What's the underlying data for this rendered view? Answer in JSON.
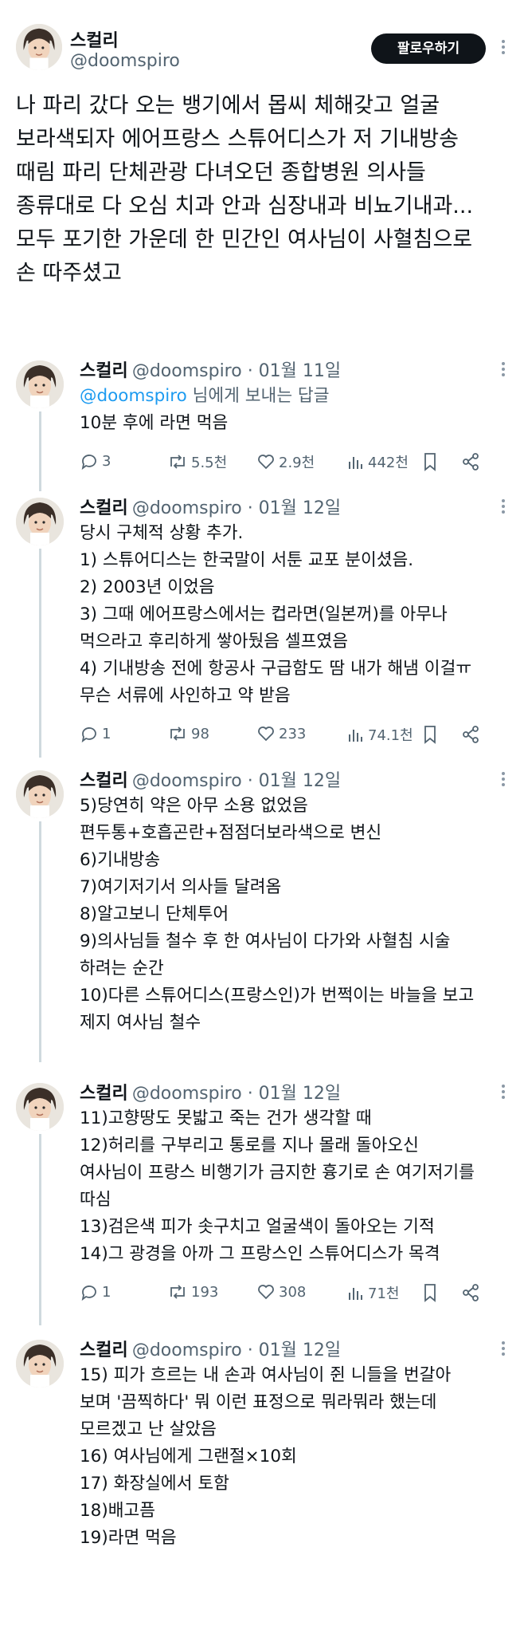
{
  "main_post": {
    "author": {
      "name": "스컬리",
      "handle": "@doomspiro"
    },
    "follow_label": "팔로우하기",
    "text_lines": [
      "나 파리 갔다 오는 뱅기에서 몹씨 체해갖고 얼굴",
      "보라색되자 에어프랑스 스튜어디스가 저 기내방송",
      "때림 파리 단체관광 다녀오던 종합병원 의사들",
      "종류대로 다 오심 치과 안과 심장내과 비뇨기내과...",
      "모두 포기한 가운데 한 민간인 여사님이 사혈침으로",
      "손 따주셨고"
    ]
  },
  "replies": [
    {
      "name": "스컬리",
      "meta": "@doomspiro · 01월 11일",
      "reply_to": {
        "mention": "@doomspiro",
        "suffix": " 님에게 보내는 답글"
      },
      "lines": [
        "10분 후에 라면 먹음"
      ],
      "stats": {
        "replies": "3",
        "retweets": "5.5천",
        "likes": "2.9천",
        "views": "442천"
      }
    },
    {
      "name": "스컬리",
      "meta": "@doomspiro · 01월 12일",
      "lines": [
        "당시 구체적 상황 추가.",
        "1) 스튜어디스는 한국말이 서툰 교포 분이셨음.",
        "2) 2003년 이었음",
        "3) 그때 에어프랑스에서는 컵라면(일본꺼)를 아무나",
        "먹으라고 후리하게 쌓아뒀음 셀프였음",
        "4) 기내방송 전에 항공사 구급함도 땀  내가 해냄 이걸ㅠ",
        "무슨 서류에 사인하고 약 받음"
      ],
      "stats": {
        "replies": "1",
        "retweets": "98",
        "likes": "233",
        "views": "74.1천"
      }
    },
    {
      "name": "스컬리",
      "meta": "@doomspiro · 01월 12일",
      "lines": [
        "5)당연히 약은 아무 소용 없었음",
        "편두통+호흡곤란+점점더보라색으로 변신",
        "6)기내방송",
        "7)여기저기서 의사들 달려옴",
        "8)알고보니 단체투어",
        "9)의사님들 철수 후 한 여사님이 다가와 사혈침 시술",
        "하려는 순간",
        "10)다른 스튜어디스(프랑스인)가 번쩍이는 바늘을 보고",
        "제지 여사님 철수"
      ]
    },
    {
      "name": "스컬리",
      "meta": "@doomspiro · 01월 12일",
      "lines": [
        "11)고향땅도 못밟고 죽는 건가 생각할 때",
        "12)허리를 구부리고 통로를 지나 몰래 돌아오신",
        "여사님이 프랑스 비행기가 금지한 흉기로 손 여기저기를",
        "따심",
        "13)검은색 피가 솟구치고 얼굴색이 돌아오는 기적",
        "14)그 광경을 아까 그 프랑스인 스튜어디스가 목격"
      ],
      "stats": {
        "replies": "1",
        "retweets": "193",
        "likes": "308",
        "views": "71천"
      }
    },
    {
      "name": "스컬리",
      "meta": "@doomspiro · 01월 12일",
      "lines": [
        "15) 피가 흐르는 내 손과 여사님이 쥔 니들을 번갈아",
        "보며 '끔찍하다' 뭐 이런 표정으로 뭐라뭐라 했는데",
        "모르겠고 난 살았음",
        "16) 여사님에게 그랜절×10회",
        "17) 화장실에서 토함",
        "18)배고픔",
        "19)라면 먹음"
      ]
    }
  ],
  "icons": {
    "reply": "comment-icon",
    "retweet": "retweet-icon",
    "like": "heart-icon",
    "views": "views-icon",
    "bookmark": "bookmark-icon",
    "share": "share-icon"
  },
  "colors": {
    "text": "#0f1419",
    "muted": "#536471",
    "mention": "#1d9bf0",
    "button": "#0f1419",
    "thread": "#cfd9de"
  }
}
